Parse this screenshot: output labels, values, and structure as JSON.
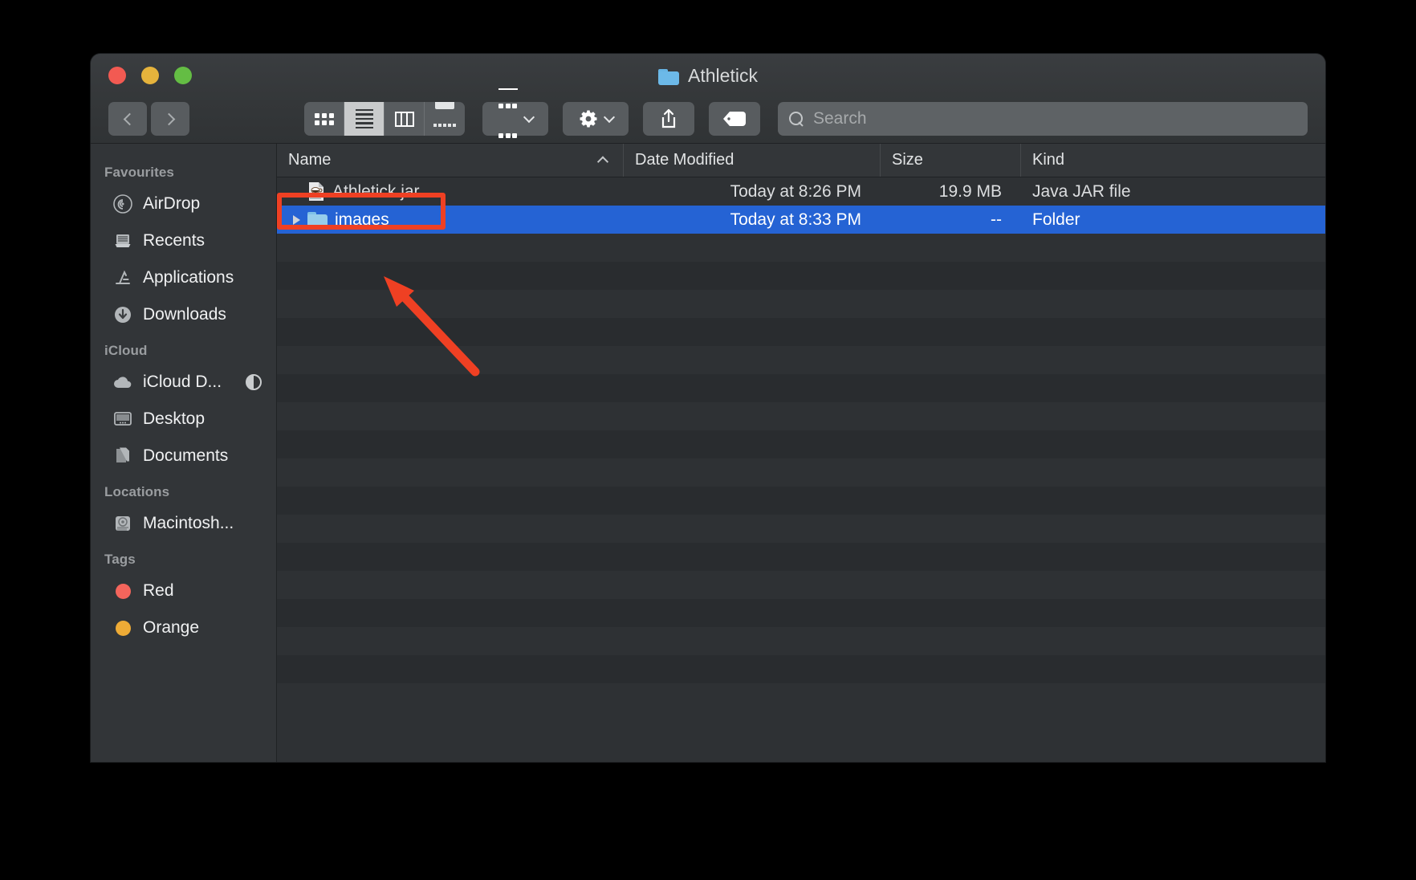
{
  "window": {
    "title": "Athletick",
    "title_icon": "folder-icon",
    "traffic_lights": [
      "close-red",
      "minimize-yellow",
      "zoom-green"
    ]
  },
  "toolbar": {
    "back_label": "Back",
    "forward_label": "Forward",
    "view_modes": [
      {
        "name": "icon-view",
        "active": false
      },
      {
        "name": "list-view",
        "active": true
      },
      {
        "name": "column-view",
        "active": false
      },
      {
        "name": "gallery-view",
        "active": false
      }
    ],
    "group_by_label": "Group",
    "action_label": "Action",
    "share_label": "Share",
    "tag_label": "Tags"
  },
  "search": {
    "placeholder": "Search",
    "value": ""
  },
  "sidebar": {
    "sections": [
      {
        "header": "Favourites",
        "items": [
          {
            "label": "AirDrop",
            "icon": "airdrop-icon"
          },
          {
            "label": "Recents",
            "icon": "recents-icon"
          },
          {
            "label": "Applications",
            "icon": "applications-icon"
          },
          {
            "label": "Downloads",
            "icon": "downloads-icon"
          }
        ]
      },
      {
        "header": "iCloud",
        "items": [
          {
            "label": "iCloud D...",
            "icon": "icloud-drive-icon",
            "badge": "sync-progress"
          },
          {
            "label": "Desktop",
            "icon": "desktop-icon"
          },
          {
            "label": "Documents",
            "icon": "documents-icon"
          }
        ]
      },
      {
        "header": "Locations",
        "items": [
          {
            "label": "Macintosh...",
            "icon": "hard-disk-icon"
          }
        ]
      },
      {
        "header": "Tags",
        "items": [
          {
            "label": "Red",
            "icon": "tag-dot-icon",
            "color": "#f4655c"
          },
          {
            "label": "Orange",
            "icon": "tag-dot-icon",
            "color": "#eeab36"
          }
        ]
      }
    ]
  },
  "file_list": {
    "columns": [
      {
        "label": "Name",
        "sorted": true,
        "sort_direction": "ascending"
      },
      {
        "label": "Date Modified"
      },
      {
        "label": "Size"
      },
      {
        "label": "Kind"
      }
    ],
    "rows": [
      {
        "name": "Athletick.jar",
        "icon": "jar-file-icon",
        "date_modified": "Today at 8:26 PM",
        "size": "19.9 MB",
        "kind": "Java JAR file",
        "selected": false,
        "expandable": false
      },
      {
        "name": "images",
        "icon": "folder-icon",
        "date_modified": "Today at 8:33 PM",
        "size": "--",
        "kind": "Folder",
        "selected": true,
        "expandable": true
      }
    ],
    "empty_row_count": 16
  },
  "annotations": {
    "highlight_color": "#ef4023",
    "highlight_target": "images",
    "arrow": "points-to-images-row"
  }
}
